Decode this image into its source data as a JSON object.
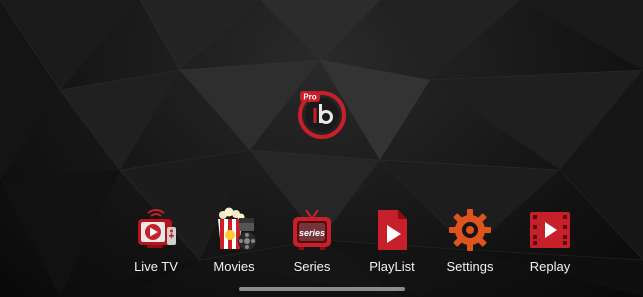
{
  "app": {
    "logo_text": "Pro",
    "accent_color": "#c8202a",
    "background_color": "#141414"
  },
  "menu": {
    "items": [
      {
        "label": "Live TV",
        "icon": "live-tv-icon"
      },
      {
        "label": "Movies",
        "icon": "movies-icon"
      },
      {
        "label": "Series",
        "icon": "series-icon"
      },
      {
        "label": "PlayList",
        "icon": "playlist-icon"
      },
      {
        "label": "Settings",
        "icon": "settings-icon"
      },
      {
        "label": "Replay",
        "icon": "replay-icon"
      }
    ]
  },
  "series_badge_text": "series"
}
